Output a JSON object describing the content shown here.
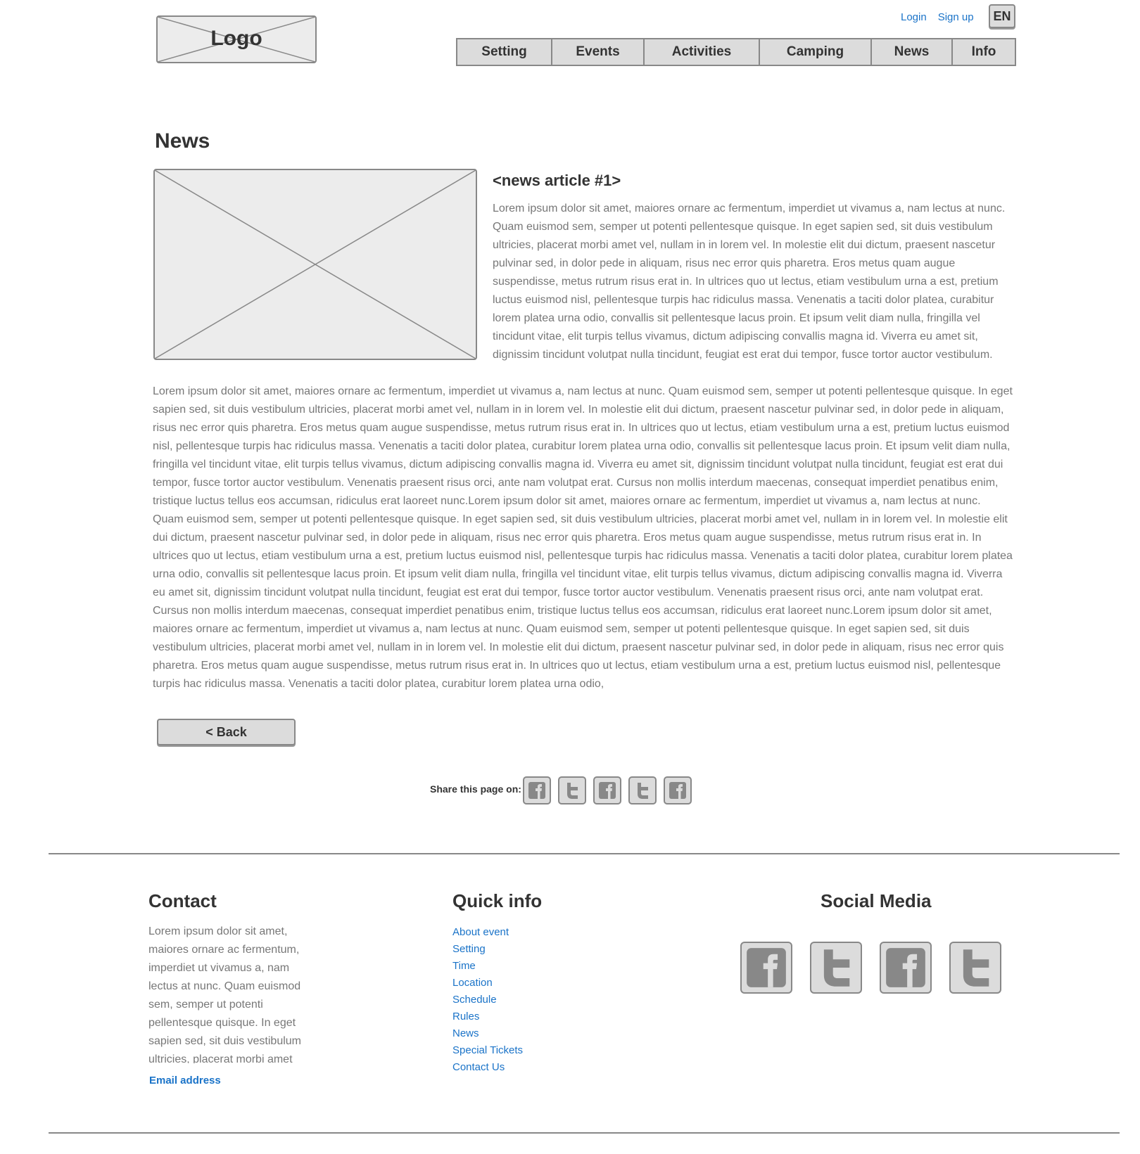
{
  "header": {
    "logo_label": "Logo",
    "login_label": "Login",
    "signup_label": "Sign up",
    "language": "EN",
    "nav": [
      {
        "label": "Setting"
      },
      {
        "label": "Events"
      },
      {
        "label": "Activities"
      },
      {
        "label": "Camping"
      },
      {
        "label": "News"
      },
      {
        "label": "Info"
      }
    ]
  },
  "main": {
    "page_title": "News",
    "article_title": "<news article #1>",
    "article_intro": "Lorem ipsum dolor sit amet, maiores ornare ac fermentum, imperdiet ut vivamus a, nam lectus at nunc. Quam euismod sem, semper ut potenti pellentesque quisque. In eget sapien sed, sit duis vestibulum ultricies, placerat morbi amet vel, nullam in in lorem vel. In molestie elit dui dictum, praesent nascetur pulvinar sed, in dolor pede in aliquam, risus nec error quis pharetra. Eros metus quam augue suspendisse, metus rutrum risus erat in.  In ultrices quo ut lectus, etiam vestibulum urna a est, pretium luctus euismod nisl, pellentesque turpis hac ridiculus massa. Venenatis a taciti dolor platea, curabitur lorem platea urna odio, convallis sit pellentesque lacus proin. Et ipsum velit diam nulla, fringilla vel tincidunt vitae, elit turpis tellus vivamus, dictum adipiscing convallis magna id. Viverra eu amet sit, dignissim tincidunt volutpat nulla tincidunt, feugiat est erat dui tempor, fusce tortor auctor vestibulum.",
    "article_body": "Lorem ipsum dolor sit amet, maiores ornare ac fermentum, imperdiet ut vivamus a, nam lectus at nunc. Quam euismod sem, semper ut potenti pellentesque quisque. In eget sapien sed, sit duis vestibulum ultricies, placerat morbi amet vel, nullam in in lorem vel. In molestie elit dui dictum, praesent nascetur pulvinar sed, in dolor pede in aliquam, risus nec error quis pharetra. Eros metus quam augue suspendisse, metus rutrum risus erat in.  In ultrices quo ut lectus, etiam vestibulum urna a est, pretium luctus euismod nisl, pellentesque turpis hac ridiculus massa. Venenatis a taciti dolor platea, curabitur lorem platea urna odio, convallis sit pellentesque lacus proin. Et ipsum velit diam nulla, fringilla vel tincidunt vitae, elit turpis tellus vivamus, dictum adipiscing convallis magna id. Viverra eu amet sit, dignissim tincidunt volutpat nulla tincidunt, feugiat est erat dui tempor, fusce tortor auctor vestibulum. Venenatis praesent risus orci, ante nam volutpat erat. Cursus non mollis interdum maecenas, consequat imperdiet penatibus enim, tristique luctus tellus eos accumsan, ridiculus erat laoreet nunc.Lorem ipsum dolor sit amet, maiores ornare ac fermentum, imperdiet ut vivamus a, nam lectus at nunc. Quam euismod sem, semper ut potenti pellentesque quisque. In eget sapien sed, sit duis vestibulum ultricies, placerat morbi amet vel, nullam in in lorem vel. In molestie elit dui dictum, praesent nascetur pulvinar sed, in dolor pede in aliquam, risus nec error quis pharetra. Eros metus quam augue suspendisse, metus rutrum risus erat in.  In ultrices quo ut lectus, etiam vestibulum urna a est, pretium luctus euismod nisl, pellentesque turpis hac ridiculus massa. Venenatis a taciti dolor platea, curabitur lorem platea urna odio, convallis sit pellentesque lacus proin. Et ipsum velit diam nulla, fringilla vel tincidunt vitae, elit turpis tellus vivamus, dictum adipiscing convallis magna id. Viverra eu amet sit, dignissim tincidunt volutpat nulla tincidunt, feugiat est erat dui tempor, fusce tortor auctor vestibulum. Venenatis praesent risus orci, ante nam volutpat erat. Cursus non mollis interdum maecenas, consequat imperdiet penatibus enim, tristique luctus tellus eos accumsan, ridiculus erat laoreet nunc.Lorem ipsum dolor sit amet, maiores ornare ac fermentum, imperdiet ut vivamus a, nam lectus at nunc. Quam euismod sem, semper ut potenti pellentesque quisque. In eget sapien sed, sit duis vestibulum ultricies, placerat morbi amet vel, nullam in in lorem vel. In molestie elit dui dictum, praesent nascetur pulvinar sed, in dolor pede in aliquam, risus nec error quis pharetra. Eros metus quam augue suspendisse, metus rutrum risus erat in.  In ultrices quo ut lectus, etiam vestibulum urna a est, pretium luctus euismod nisl, pellentesque turpis hac ridiculus massa. Venenatis a taciti dolor platea, curabitur lorem platea urna odio,",
    "back_label": "< Back",
    "share_label": "Share this page on:",
    "share_icons": [
      "facebook-icon",
      "twitter-icon",
      "facebook-icon",
      "twitter-icon",
      "facebook-icon"
    ]
  },
  "footer": {
    "contact_heading": "Contact",
    "contact_text": "Lorem ipsum dolor sit amet, maiores ornare ac fermentum, imperdiet ut vivamus a, nam lectus at nunc. Quam euismod sem, semper ut potenti pellentesque quisque. In eget sapien sed, sit duis vestibulum ultricies, placerat morbi amet",
    "email_label": "Email address",
    "quick_heading": "Quick info",
    "quick_links": [
      "About event",
      "Setting",
      "Time",
      "Location",
      "Schedule",
      "Rules",
      "News",
      "Special Tickets",
      "Contact Us"
    ],
    "social_heading": "Social Media",
    "social_icons": [
      "facebook-icon",
      "twitter-icon",
      "facebook-icon",
      "twitter-icon"
    ]
  },
  "colors": {
    "link": "#1a73c8",
    "wireframe_fill": "#dcdcdc",
    "wireframe_border": "#888888",
    "body_text": "#777777"
  }
}
